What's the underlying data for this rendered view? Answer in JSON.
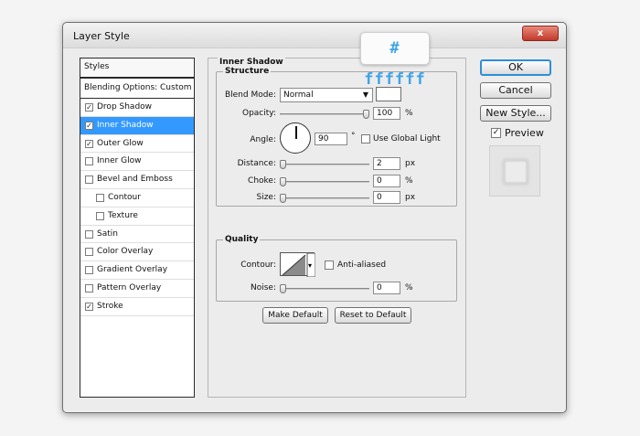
{
  "window": {
    "title": "Layer Style",
    "close_glyph": "x"
  },
  "styles_list": {
    "header": "Styles",
    "blending": "Blending Options: Custom",
    "items": [
      {
        "label": "Drop Shadow",
        "checked": true
      },
      {
        "label": "Inner Shadow",
        "checked": true,
        "selected": true
      },
      {
        "label": "Outer Glow",
        "checked": true
      },
      {
        "label": "Inner Glow",
        "checked": false
      },
      {
        "label": "Bevel and Emboss",
        "checked": false
      },
      {
        "label": "Contour",
        "checked": false,
        "sub": true
      },
      {
        "label": "Texture",
        "checked": false,
        "sub": true
      },
      {
        "label": "Satin",
        "checked": false
      },
      {
        "label": "Color Overlay",
        "checked": false
      },
      {
        "label": "Gradient Overlay",
        "checked": false
      },
      {
        "label": "Pattern Overlay",
        "checked": false
      },
      {
        "label": "Stroke",
        "checked": true
      }
    ]
  },
  "panel": {
    "title": "Inner Shadow",
    "structure": {
      "title": "Structure",
      "blend_mode_label": "Blend Mode:",
      "blend_mode_value": "Normal",
      "color": "#ffffff",
      "opacity_label": "Opacity:",
      "opacity_value": "100",
      "angle_label": "Angle:",
      "angle_value": "90",
      "degree_unit": "°",
      "use_global_light_label": "Use Global Light",
      "distance_label": "Distance:",
      "distance_value": "2",
      "choke_label": "Choke:",
      "choke_value": "0",
      "size_label": "Size:",
      "size_value": "0",
      "unit_px": "px",
      "unit_pct": "%"
    },
    "quality": {
      "title": "Quality",
      "contour_label": "Contour:",
      "anti_aliased_label": "Anti-aliased",
      "noise_label": "Noise:",
      "noise_value": "0",
      "unit_pct": "%"
    },
    "make_default": "Make Default",
    "reset_default": "Reset to Default"
  },
  "buttons": {
    "ok": "OK",
    "cancel": "Cancel",
    "new_style": "New Style...",
    "preview_label": "Preview",
    "preview_checked": true
  },
  "hex_badge": "# ffffff"
}
